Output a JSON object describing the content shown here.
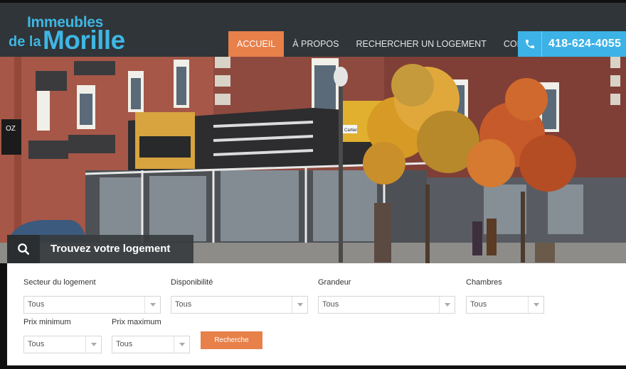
{
  "logo": {
    "line1": "Immeubles",
    "line2": "de la",
    "line3": "Morille"
  },
  "nav": {
    "items": [
      {
        "label": "ACCUEIL",
        "active": true
      },
      {
        "label": "À PROPOS",
        "active": false
      },
      {
        "label": "RECHERCHER UN LOGEMENT",
        "active": false
      },
      {
        "label": "CONTACT",
        "active": false
      }
    ]
  },
  "phone": {
    "icon": "phone-icon",
    "number": "418-624-4055"
  },
  "search": {
    "icon": "search-icon",
    "title": "Trouvez votre logement"
  },
  "filters": {
    "secteur": {
      "label": "Secteur du logement",
      "value": "Tous"
    },
    "disponibilite": {
      "label": "Disponibilité",
      "value": "Tous"
    },
    "grandeur": {
      "label": "Grandeur",
      "value": "Tous"
    },
    "chambres": {
      "label": "Chambres",
      "value": "Tous"
    },
    "prix_min": {
      "label": "Prix minimum",
      "value": "Tous"
    },
    "prix_max": {
      "label": "Prix maximum",
      "value": "Tous"
    }
  },
  "submit": {
    "label": "Recherche"
  },
  "storefront": {
    "sign": "OZ",
    "street_sign": "Cartier"
  },
  "colors": {
    "accent": "#e8804a",
    "brand": "#3fb6e3",
    "header": "#2f3538",
    "phone_bg": "#3cb2e6"
  }
}
